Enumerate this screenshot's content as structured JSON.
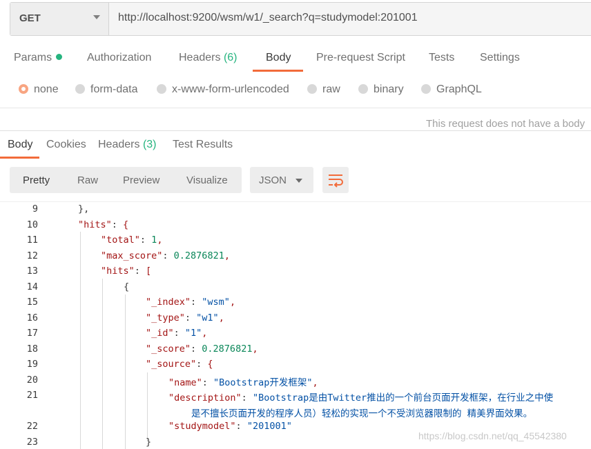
{
  "request": {
    "method": "GET",
    "url": "http://localhost:9200/wsm/w1/_search?q=studymodel:201001"
  },
  "request_tabs": [
    {
      "label": "Params",
      "count": ""
    },
    {
      "label": "Authorization",
      "count": ""
    },
    {
      "label": "Headers",
      "count": "(6)"
    },
    {
      "label": "Body",
      "count": ""
    },
    {
      "label": "Pre-request Script",
      "count": ""
    },
    {
      "label": "Tests",
      "count": ""
    },
    {
      "label": "Settings",
      "count": ""
    }
  ],
  "active_request_tab": "Body",
  "body_types": [
    "none",
    "form-data",
    "x-www-form-urlencoded",
    "raw",
    "binary",
    "GraphQL"
  ],
  "selected_body_type": "none",
  "no_body_message": "This request does not have a body",
  "response_tabs": [
    {
      "label": "Body",
      "count": ""
    },
    {
      "label": "Cookies",
      "count": ""
    },
    {
      "label": "Headers",
      "count": "(3)"
    },
    {
      "label": "Test Results",
      "count": ""
    }
  ],
  "view_modes": [
    "Pretty",
    "Raw",
    "Preview",
    "Visualize"
  ],
  "format": "JSON",
  "code_lines": [
    {
      "num": "9",
      "text": "},"
    },
    {
      "num": "10",
      "text": "\"hits\": {"
    },
    {
      "num": "11",
      "text": "\"total\": 1,"
    },
    {
      "num": "12",
      "text": "\"max_score\": 0.2876821,"
    },
    {
      "num": "13",
      "text": "\"hits\": ["
    },
    {
      "num": "14",
      "text": "{"
    },
    {
      "num": "15",
      "text": "\"_index\": \"wsm\","
    },
    {
      "num": "16",
      "text": "\"_type\": \"w1\","
    },
    {
      "num": "17",
      "text": "\"_id\": \"1\","
    },
    {
      "num": "18",
      "text": "\"_score\": 0.2876821,"
    },
    {
      "num": "19",
      "text": "\"_source\": {"
    },
    {
      "num": "20",
      "text": "\"name\": \"Bootstrap开发框架\","
    },
    {
      "num": "21",
      "text": "\"description\": \"Bootstrap是由Twitter推出的一个前台页面开发框架，在行业之中使"
    },
    {
      "num": "",
      "text": "是不擅长页面开发的程序人员）轻松的实现一个不受浏览器限制的 精美界面效果。"
    },
    {
      "num": "22",
      "text": "\"studymodel\": \"201001\""
    },
    {
      "num": "23",
      "text": "}"
    }
  ],
  "watermark": "https://blog.csdn.net/qq_45542380",
  "colors": {
    "accent": "#f26b3a",
    "count_green": "#26b47f",
    "json_key": "#a31515",
    "json_string": "#0451a5",
    "json_number": "#098658"
  }
}
